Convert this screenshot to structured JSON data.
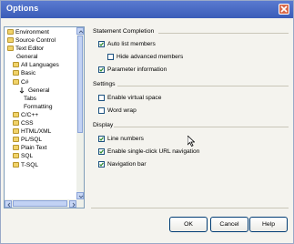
{
  "window": {
    "title": "Options"
  },
  "tree": {
    "items": [
      {
        "label": "Environment",
        "indent": 0,
        "folder": true
      },
      {
        "label": "Source Control",
        "indent": 0,
        "folder": true
      },
      {
        "label": "Text Editor",
        "indent": 0,
        "folder": true
      },
      {
        "label": "General",
        "indent": 1,
        "folder": false
      },
      {
        "label": "All Languages",
        "indent": 1,
        "folder": true
      },
      {
        "label": "Basic",
        "indent": 1,
        "folder": true
      },
      {
        "label": "C#",
        "indent": 1,
        "folder": true
      },
      {
        "label": "General",
        "indent": 2,
        "folder": false,
        "selected": true
      },
      {
        "label": "Tabs",
        "indent": 2,
        "folder": false
      },
      {
        "label": "Formatting",
        "indent": 2,
        "folder": false
      },
      {
        "label": "C/C++",
        "indent": 1,
        "folder": true
      },
      {
        "label": "CSS",
        "indent": 1,
        "folder": true
      },
      {
        "label": "HTML/XML",
        "indent": 1,
        "folder": true
      },
      {
        "label": "PL/SQL",
        "indent": 1,
        "folder": true
      },
      {
        "label": "Plain Text",
        "indent": 1,
        "folder": true
      },
      {
        "label": "SQL",
        "indent": 1,
        "folder": true
      },
      {
        "label": "T-SQL",
        "indent": 1,
        "folder": true
      }
    ]
  },
  "groups": {
    "statement_completion": {
      "title": "Statement Completion",
      "auto_list_members": {
        "label": "Auto list members",
        "checked": true
      },
      "hide_advanced_members": {
        "label": "Hide advanced members",
        "checked": false
      },
      "parameter_information": {
        "label": "Parameter information",
        "checked": true
      }
    },
    "settings": {
      "title": "Settings",
      "enable_virtual_space": {
        "label": "Enable virtual space",
        "checked": false
      },
      "word_wrap": {
        "label": "Word wrap",
        "checked": false
      }
    },
    "display": {
      "title": "Display",
      "line_numbers": {
        "label": "Line numbers",
        "checked": true
      },
      "single_click_url": {
        "label": "Enable single-click URL navigation",
        "checked": true
      },
      "navigation_bar": {
        "label": "Navigation bar",
        "checked": true
      }
    }
  },
  "buttons": {
    "ok": "OK",
    "cancel": "Cancel",
    "help": "Help"
  },
  "colors": {
    "title_bar": "#3a5cb8",
    "close_button": "#d96a4a",
    "checkbox_border": "#1c5180"
  }
}
